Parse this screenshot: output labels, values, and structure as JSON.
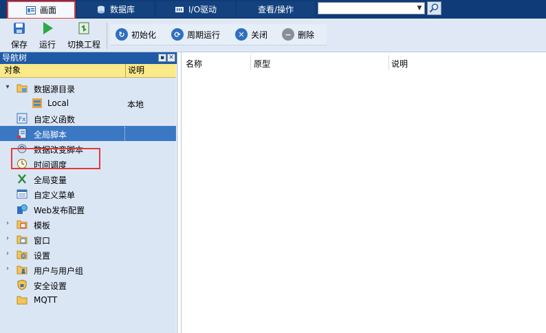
{
  "tabs": [
    {
      "label": "画面",
      "icon": "screen-icon",
      "active": true
    },
    {
      "label": "数据库",
      "icon": "database-icon",
      "active": false
    },
    {
      "label": "I/O驱动",
      "icon": "io-driver-icon",
      "active": false
    },
    {
      "label": "查看/操作",
      "icon": "",
      "active": false
    }
  ],
  "search": {
    "value": "",
    "button_icon": "magnifier-icon"
  },
  "toolbar": {
    "save_label": "保存",
    "run_label": "运行",
    "switch_label": "切换工程",
    "init_label": "初始化",
    "cycle_label": "周期运行",
    "close_label": "关闭",
    "delete_label": "删除"
  },
  "nav": {
    "title": "导航树",
    "col_object": "对象",
    "col_desc": "说明",
    "items": [
      {
        "label": "数据源目录",
        "icon": "datasource-folder-icon",
        "expander": "▾",
        "value": ""
      },
      {
        "label": "Local",
        "icon": "local-source-icon",
        "expander": "",
        "value": "本地"
      },
      {
        "label": "自定义函数",
        "icon": "function-icon",
        "expander": "",
        "value": ""
      },
      {
        "label": "全局脚本",
        "icon": "script-icon",
        "expander": "",
        "value": "",
        "selected": true
      },
      {
        "label": "数据改变脚本",
        "icon": "data-change-icon",
        "expander": "",
        "value": ""
      },
      {
        "label": "时间调度",
        "icon": "clock-icon",
        "expander": "",
        "value": ""
      },
      {
        "label": "全局变量",
        "icon": "variable-icon",
        "expander": "",
        "value": ""
      },
      {
        "label": "自定义菜单",
        "icon": "menu-icon",
        "expander": "",
        "value": ""
      },
      {
        "label": "Web发布配置",
        "icon": "web-publish-icon",
        "expander": "",
        "value": ""
      },
      {
        "label": "模板",
        "icon": "template-folder-icon",
        "expander": "›",
        "value": ""
      },
      {
        "label": "窗口",
        "icon": "window-folder-icon",
        "expander": "›",
        "value": ""
      },
      {
        "label": "设置",
        "icon": "settings-folder-icon",
        "expander": "›",
        "value": ""
      },
      {
        "label": "用户与用户组",
        "icon": "users-folder-icon",
        "expander": "›",
        "value": ""
      },
      {
        "label": "安全设置",
        "icon": "security-icon",
        "expander": "",
        "value": ""
      },
      {
        "label": "MQTT",
        "icon": "mqtt-folder-icon",
        "expander": "",
        "value": ""
      }
    ]
  },
  "content": {
    "col_name": "名称",
    "col_proto": "原型",
    "col_desc": "说明"
  },
  "colors": {
    "nav_bg": "#dbe6f4",
    "selected": "#3b78c4",
    "header": "#0f3b78",
    "highlight": "#e03a3a"
  }
}
